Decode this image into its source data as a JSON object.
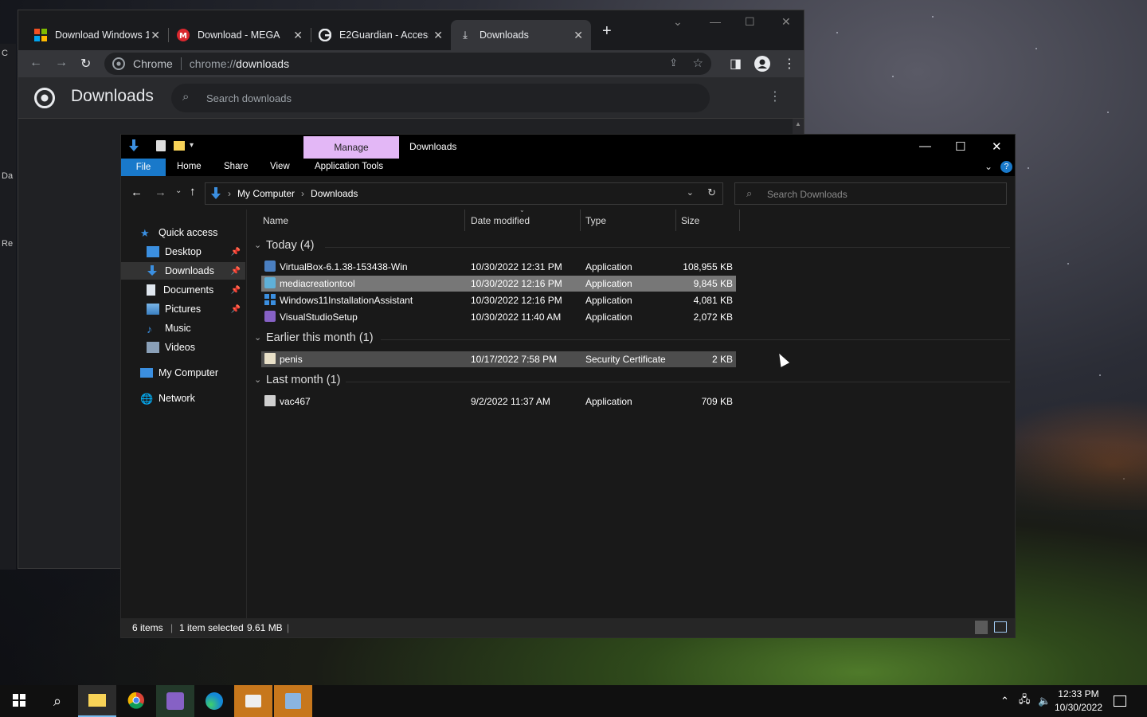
{
  "desktop": {
    "side_labels": [
      "C",
      "Da",
      "Re"
    ]
  },
  "chrome": {
    "tabs": [
      {
        "title": "Download Windows 1",
        "icon": "microsoft-logo-icon"
      },
      {
        "title": "Download - MEGA",
        "icon": "mega-logo-icon"
      },
      {
        "title": "E2Guardian - Access",
        "icon": "google-logo-icon"
      },
      {
        "title": "Downloads",
        "icon": "download-icon"
      }
    ],
    "omnibox_label": "Chrome",
    "url_scheme": "chrome://",
    "url_host": "downloads",
    "page_title": "Downloads",
    "search_placeholder": "Search downloads"
  },
  "explorer": {
    "manage_label": "Manage",
    "window_title": "Downloads",
    "ribbon": {
      "file": "File",
      "home": "Home",
      "share": "Share",
      "view": "View",
      "app_tools": "Application Tools"
    },
    "breadcrumb": [
      "My Computer",
      "Downloads"
    ],
    "search_placeholder": "Search Downloads",
    "nav": {
      "quick_access": "Quick access",
      "desktop": "Desktop",
      "downloads": "Downloads",
      "documents": "Documents",
      "pictures": "Pictures",
      "music": "Music",
      "videos": "Videos",
      "my_computer": "My Computer",
      "network": "Network"
    },
    "columns": {
      "name": "Name",
      "date": "Date modified",
      "type": "Type",
      "size": "Size"
    },
    "groups": {
      "today": "Today (4)",
      "earlier": "Earlier this month (1)",
      "last": "Last month (1)"
    },
    "files": [
      {
        "name": "VirtualBox-6.1.38-153438-Win",
        "date": "10/30/2022 12:31 PM",
        "type": "Application",
        "size": "108,955 KB"
      },
      {
        "name": "mediacreationtool",
        "date": "10/30/2022 12:16 PM",
        "type": "Application",
        "size": "9,845 KB"
      },
      {
        "name": "Windows11InstallationAssistant",
        "date": "10/30/2022 12:16 PM",
        "type": "Application",
        "size": "4,081 KB"
      },
      {
        "name": "VisualStudioSetup",
        "date": "10/30/2022 11:40 AM",
        "type": "Application",
        "size": "2,072 KB"
      },
      {
        "name": "penis",
        "date": "10/17/2022 7:58 PM",
        "type": "Security Certificate",
        "size": "2 KB"
      },
      {
        "name": "vac467",
        "date": "9/2/2022 11:37 AM",
        "type": "Application",
        "size": "709 KB"
      }
    ],
    "status": {
      "items": "6 items",
      "selected": "1 item selected",
      "selected_size": "9.61 MB"
    }
  },
  "taskbar": {
    "time": "12:33 PM",
    "date": "10/30/2022"
  },
  "colors": {
    "file_tab": "#1979ca",
    "manage_tab": "#e3b7f6",
    "selection": "#777777"
  }
}
